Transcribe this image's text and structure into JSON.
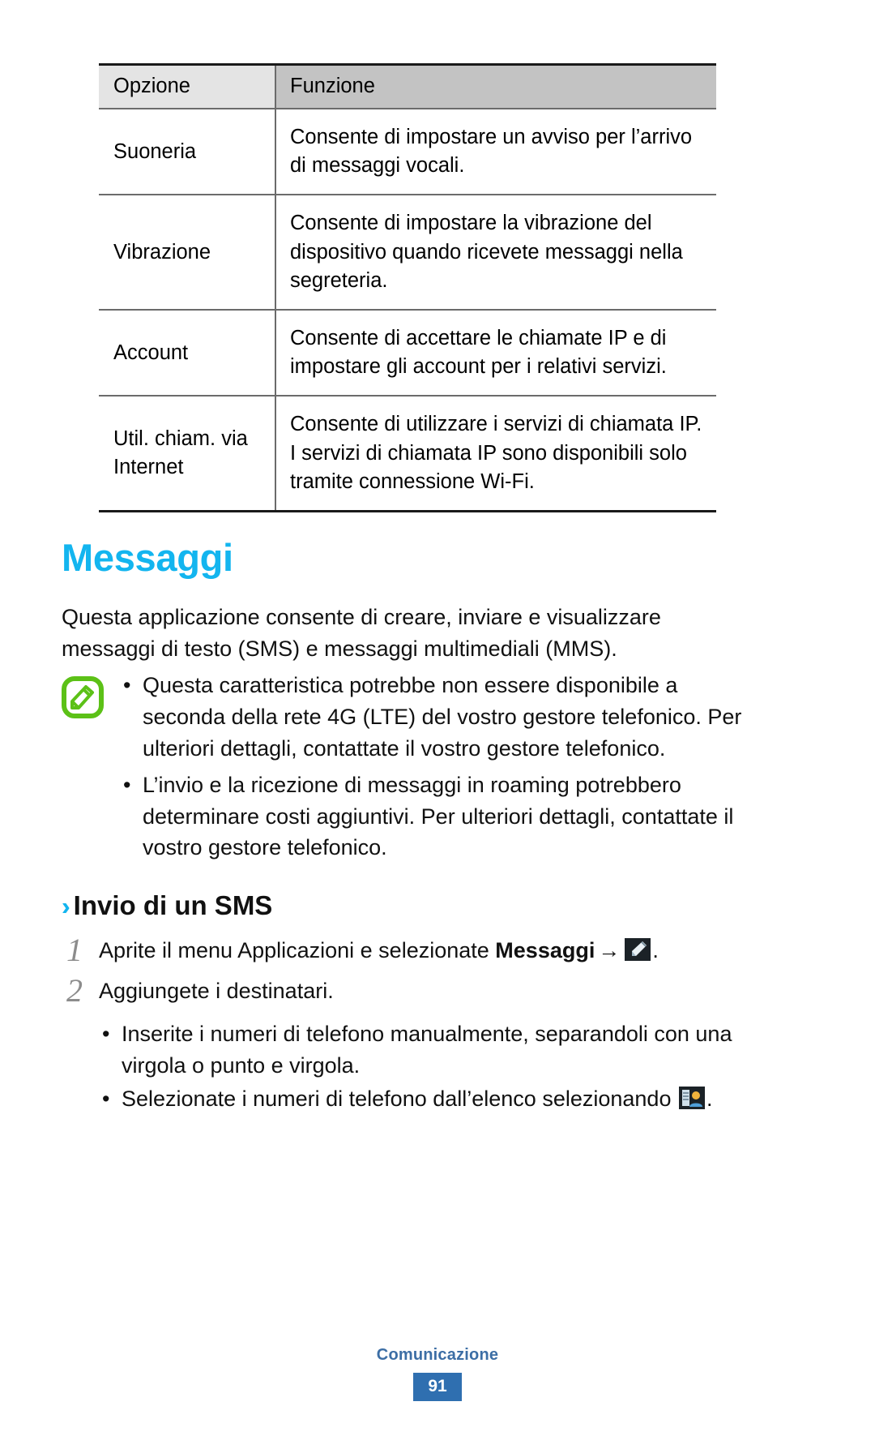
{
  "table": {
    "headers": [
      "Opzione",
      "Funzione"
    ],
    "rows": [
      {
        "option": "Suoneria",
        "function": "Consente di impostare un avviso per l’arrivo di messaggi vocali."
      },
      {
        "option": "Vibrazione",
        "function": "Consente di impostare la vibrazione del dispositivo quando ricevete messaggi nella segreteria."
      },
      {
        "option": "Account",
        "function": "Consente di accettare le chiamate IP e di impostare gli account per i relativi servizi."
      },
      {
        "option": "Util. chiam. via Internet",
        "function": "Consente di utilizzare i servizi di chiamata IP. I servizi di chiamata IP sono disponibili solo tramite connessione Wi-Fi."
      }
    ]
  },
  "chapter": {
    "title": "Messaggi",
    "intro": "Questa applicazione consente di creare, inviare e visualizzare messaggi di testo (SMS) e messaggi multimediali (MMS).",
    "note": {
      "icon": "note-pencil-icon",
      "bullets": [
        "Questa caratteristica potrebbe non essere disponibile a seconda della rete 4G (LTE) del vostro gestore telefonico. Per ulteriori dettagli, contattate il vostro gestore telefonico.",
        "L’invio e la ricezione di messaggi in roaming potrebbero determinare costi aggiuntivi. Per ulteriori dettagli, contattate il vostro gestore telefonico."
      ],
      "bullet_char": "•"
    }
  },
  "section": {
    "chevron": "››",
    "title": "Invio di un SMS",
    "steps": [
      {
        "number": "1",
        "text_before": "Aprite il menu Applicazioni e selezionate ",
        "bold": "Messaggi",
        "arrow": "→",
        "icon": "compose-message-icon",
        "text_after": "."
      },
      {
        "number": "2",
        "text_before": "Aggiungete i destinatari.",
        "bold": "",
        "arrow": "",
        "icon": "",
        "text_after": ""
      }
    ],
    "sub_bullets": [
      {
        "text_before": "Inserite i numeri di telefono manualmente, separandoli con una virgola o punto e virgola.",
        "icon": "",
        "text_after": ""
      },
      {
        "text_before": "Selezionate i numeri di telefono dall’elenco selezionando ",
        "icon": "contacts-picker-icon",
        "text_after": "."
      }
    ],
    "bullet_char": "•"
  },
  "footer": {
    "label": "Comunicazione",
    "page": "91"
  },
  "colors": {
    "chapter_heading": "#13b5ef",
    "chevron": "#13b5ef",
    "note_icon_green": "#5cc117",
    "step_number_gray": "#8c8c8c",
    "footer_label": "#3c6ea5",
    "footer_page_bg": "#2f6fb0",
    "header_cell_1_bg": "#e4e4e4",
    "header_cell_2_bg": "#c3c3c3"
  }
}
